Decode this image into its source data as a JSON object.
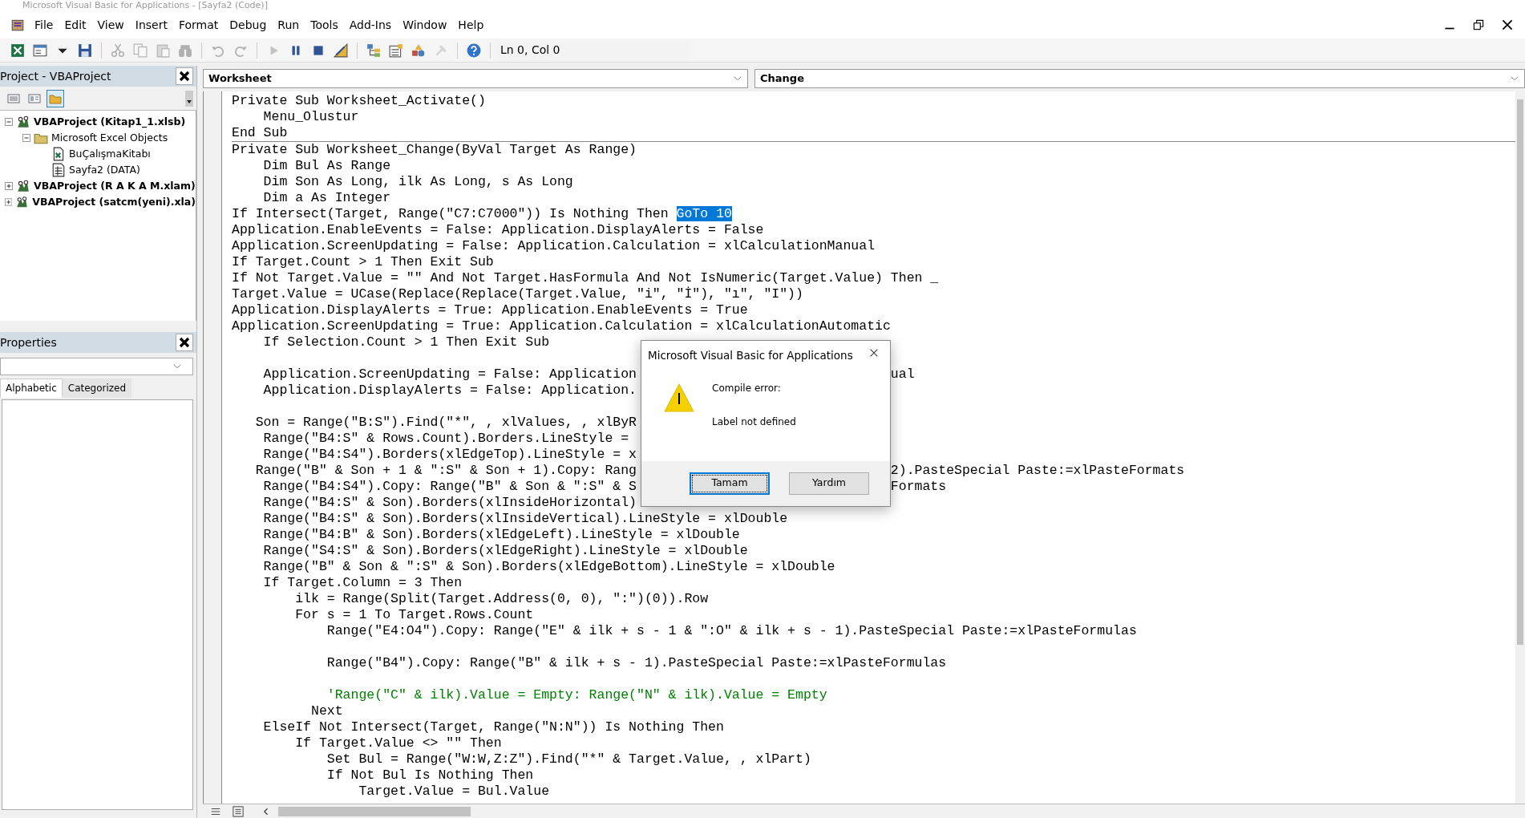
{
  "window": {
    "title": "Microsoft Visual Basic for Applications - [Sayfa2 (Code)]"
  },
  "menu": [
    "File",
    "Edit",
    "View",
    "Insert",
    "Format",
    "Debug",
    "Run",
    "Tools",
    "Add-Ins",
    "Window",
    "Help"
  ],
  "toolbar": {
    "groups": [
      [
        {
          "kind": "excel",
          "disabled": false
        },
        {
          "kind": "userform",
          "disabled": false
        },
        {
          "kind": "caret",
          "disabled": false
        },
        {
          "kind": "save",
          "disabled": false
        }
      ],
      [
        {
          "kind": "cut",
          "disabled": true
        },
        {
          "kind": "copy",
          "disabled": true
        },
        {
          "kind": "paste",
          "disabled": true
        },
        {
          "kind": "find",
          "disabled": true
        }
      ],
      [
        {
          "kind": "undo",
          "disabled": true
        },
        {
          "kind": "redo",
          "disabled": true
        }
      ],
      [
        {
          "kind": "run",
          "disabled": true
        },
        {
          "kind": "pause",
          "disabled": false
        },
        {
          "kind": "stop",
          "disabled": false
        },
        {
          "kind": "design",
          "disabled": false
        }
      ],
      [
        {
          "kind": "explorer",
          "disabled": false
        },
        {
          "kind": "properties",
          "disabled": false
        },
        {
          "kind": "browser",
          "disabled": false
        },
        {
          "kind": "toolbox",
          "disabled": true
        }
      ],
      [
        {
          "kind": "help",
          "disabled": false
        }
      ]
    ],
    "position": "Ln 0, Col 0"
  },
  "project": {
    "title": "Project - VBAProject",
    "buttons": [
      {
        "kind": "code",
        "on": false
      },
      {
        "kind": "object",
        "on": false
      },
      {
        "kind": "folders",
        "on": true
      }
    ],
    "tree": [
      {
        "label": "VBAProject (Kitap1_1.xlsb)",
        "kind": "project",
        "expanded": true,
        "children": [
          {
            "label": "Microsoft Excel Objects",
            "kind": "folder",
            "expanded": true,
            "children": [
              {
                "label": "BuÇalışmaKitabı",
                "kind": "workbook"
              },
              {
                "label": "Sayfa2 (DATA)",
                "kind": "sheet"
              }
            ]
          }
        ]
      },
      {
        "label": "VBAProject (R A K A M.xlam)",
        "kind": "project",
        "expanded": false
      },
      {
        "label": "VBAProject (satcm(yeni).xla)",
        "kind": "project",
        "expanded": false
      }
    ]
  },
  "properties": {
    "title": "Properties",
    "tabs": [
      {
        "label": "Alphabetic",
        "selected": true
      },
      {
        "label": "Categorized",
        "selected": false
      }
    ]
  },
  "code_window": {
    "object": "Worksheet",
    "procedure": "Change",
    "procedures": [
      {
        "lines": [
          {
            "kind": "code",
            "text": "Private Sub Worksheet_Activate()"
          },
          {
            "kind": "code",
            "text": "    Menu_Olustur"
          },
          {
            "kind": "code",
            "text": "End Sub"
          }
        ]
      },
      {
        "lines": [
          {
            "kind": "code",
            "text": "Private Sub Worksheet_Change(ByVal Target As Range)"
          },
          {
            "kind": "code",
            "text": "    Dim Bul As Range"
          },
          {
            "kind": "code",
            "text": "    Dim Son As Long, ilk As Long, s As Long"
          },
          {
            "kind": "code",
            "text": "    Dim a As Integer"
          },
          {
            "kind": "code",
            "text": "If Intersect(Target, Range(\"C7:C7000\")) Is Nothing Then ",
            "selected_text": "GoTo 10"
          },
          {
            "kind": "code",
            "text": "Application.EnableEvents = False: Application.DisplayAlerts = False"
          },
          {
            "kind": "code",
            "text": "Application.ScreenUpdating = False: Application.Calculation = xlCalculationManual"
          },
          {
            "kind": "code",
            "text": "If Target.Count > 1 Then Exit Sub"
          },
          {
            "kind": "code",
            "text": "If Not Target.Value = \"\" And Not Target.HasFormula And Not IsNumeric(Target.Value) Then _"
          },
          {
            "kind": "code",
            "text": "Target.Value = UCase(Replace(Replace(Target.Value, \"i\", \"İ\"), \"ı\", \"I\"))"
          },
          {
            "kind": "code",
            "text": "Application.DisplayAlerts = True: Application.EnableEvents = True"
          },
          {
            "kind": "code",
            "text": "Application.ScreenUpdating = True: Application.Calculation = xlCalculationAutomatic"
          },
          {
            "kind": "code",
            "text": "    If Selection.Count > 1 Then Exit Sub"
          },
          {
            "kind": "blank"
          },
          {
            "kind": "code",
            "text": "    Application.ScreenUpdating = False: Application",
            "tail": "ual"
          },
          {
            "kind": "code",
            "text": "    Application.DisplayAlerts = False: Application."
          },
          {
            "kind": "blank"
          },
          {
            "kind": "code",
            "text": "   Son = Range(\"B:S\").Find(\"*\", , xlValues, , xlByR"
          },
          {
            "kind": "code",
            "text": "    Range(\"B4:S\" & Rows.Count).Borders.LineStyle ="
          },
          {
            "kind": "code",
            "text": "    Range(\"B4:S4\").Borders(xlEdgeTop).LineStyle = x"
          },
          {
            "kind": "code",
            "text": "   Range(\"B\" & Son + 1 & \":S\" & Son + 1).Copy: Rang",
            "tail": "2).PasteSpecial Paste:=xlPasteFormats"
          },
          {
            "kind": "code",
            "text": "    Range(\"B4:S4\").Copy: Range(\"B\" & Son & \":S\" & S",
            "tail": "Formats"
          },
          {
            "kind": "code",
            "text": "    Range(\"B4:S\" & Son).Borders(xlInsideHorizontal)"
          },
          {
            "kind": "code",
            "text": "    Range(\"B4:S\" & Son).Borders(xlInsideVertical).LineStyle = xlDouble"
          },
          {
            "kind": "code",
            "text": "    Range(\"B4:B\" & Son).Borders(xlEdgeLeft).LineStyle = xlDouble"
          },
          {
            "kind": "code",
            "text": "    Range(\"S4:S\" & Son).Borders(xlEdgeRight).LineStyle = xlDouble"
          },
          {
            "kind": "code",
            "text": "    Range(\"B\" & Son & \":S\" & Son).Borders(xlEdgeBottom).LineStyle = xlDouble"
          },
          {
            "kind": "code",
            "text": "    If Target.Column = 3 Then"
          },
          {
            "kind": "code",
            "text": "        ilk = Range(Split(Target.Address(0, 0), \":\")(0)).Row"
          },
          {
            "kind": "code",
            "text": "        For s = 1 To Target.Rows.Count"
          },
          {
            "kind": "code",
            "text": "            Range(\"E4:O4\").Copy: Range(\"E\" & ilk + s - 1 & \":O\" & ilk + s - 1).PasteSpecial Paste:=xlPasteFormulas"
          },
          {
            "kind": "blank"
          },
          {
            "kind": "code",
            "text": "            Range(\"B4\").Copy: Range(\"B\" & ilk + s - 1).PasteSpecial Paste:=xlPasteFormulas"
          },
          {
            "kind": "blank"
          },
          {
            "kind": "comment",
            "text": "            'Range(\"C\" & ilk).Value = Empty: Range(\"N\" & ilk).Value = Empty"
          },
          {
            "kind": "code",
            "text": "          Next"
          },
          {
            "kind": "code",
            "text": "    ElseIf Not Intersect(Target, Range(\"N:N\")) Is Nothing Then"
          },
          {
            "kind": "code",
            "text": "        If Target.Value <> \"\" Then"
          },
          {
            "kind": "code",
            "text": "            Set Bul = Range(\"W:W,Z:Z\").Find(\"*\" & Target.Value, , xlPart)"
          },
          {
            "kind": "code",
            "text": "            If Not Bul Is Nothing Then"
          },
          {
            "kind": "code",
            "text": "                Target.Value = Bul.Value"
          }
        ]
      }
    ]
  },
  "dialog": {
    "title": "Microsoft Visual Basic for Applications",
    "heading": "Compile error:",
    "message": "Label not defined",
    "buttons": [
      {
        "label": "Tamam",
        "default": true
      },
      {
        "label": "Yardım",
        "default": false
      }
    ]
  }
}
